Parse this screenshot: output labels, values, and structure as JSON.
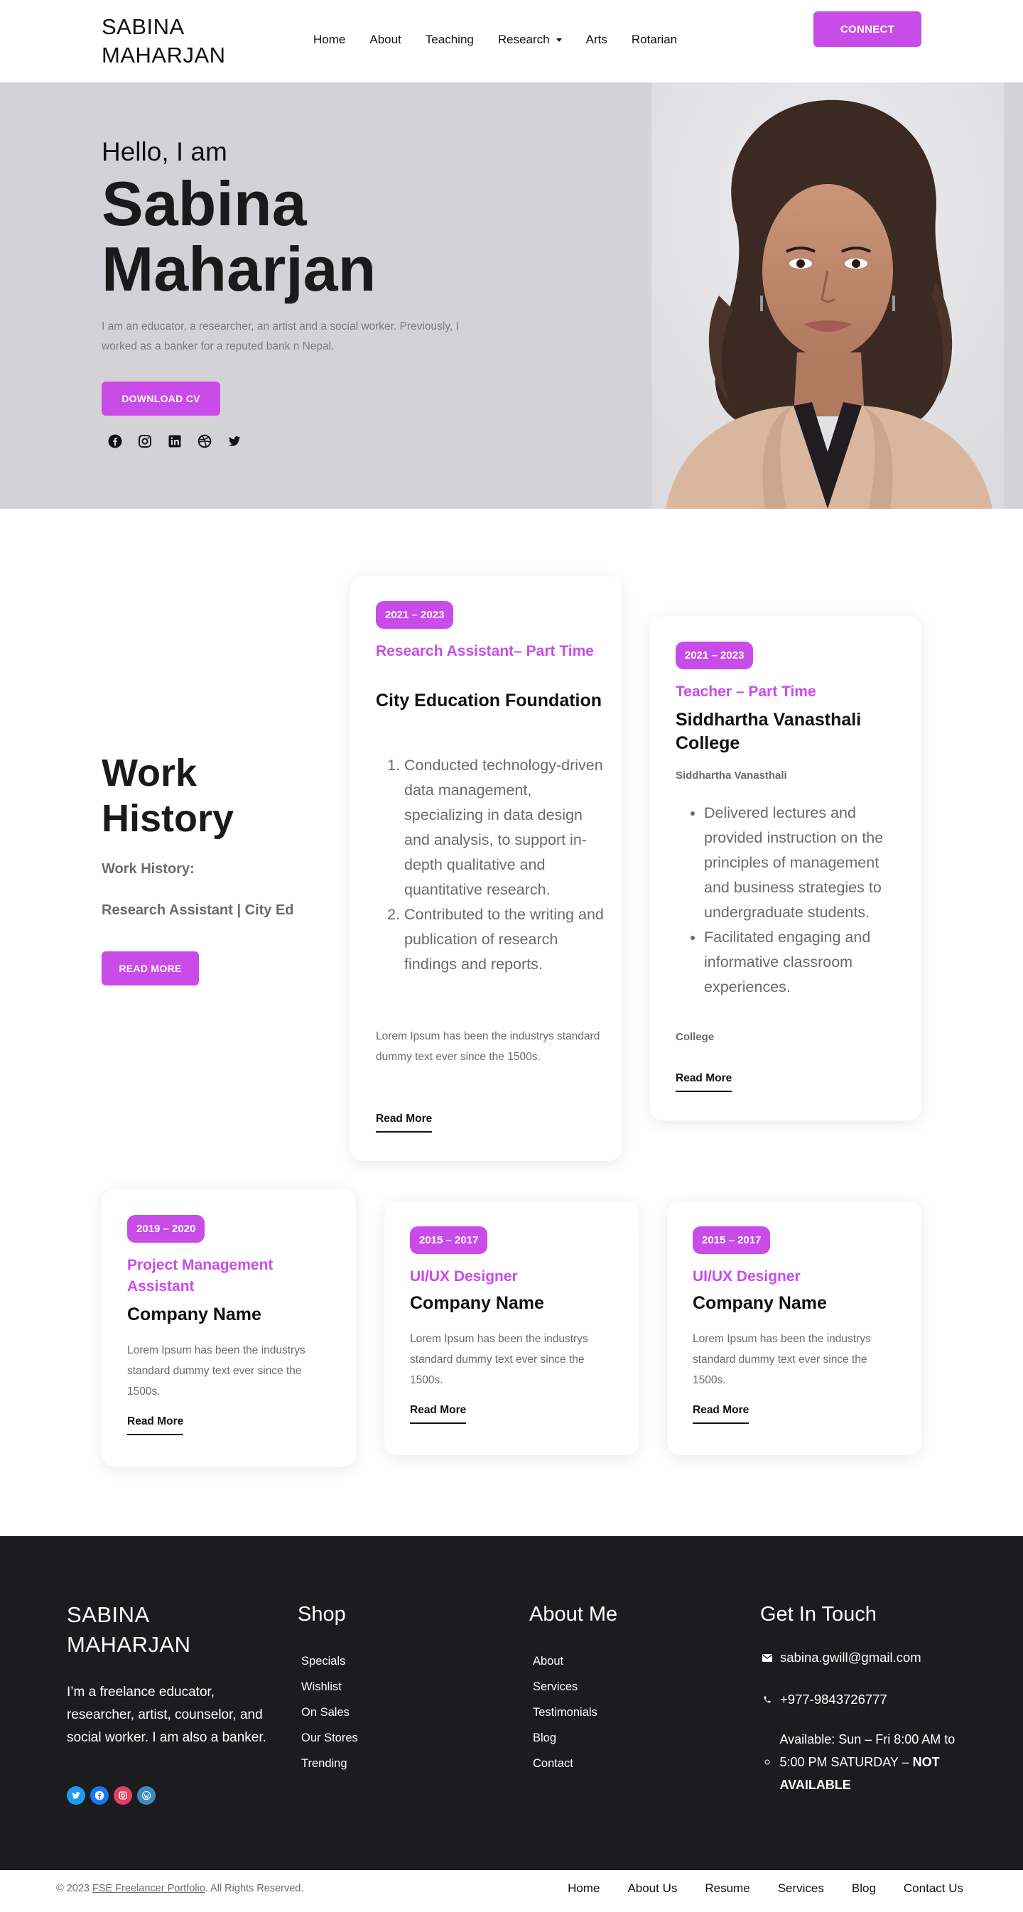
{
  "header": {
    "brand": "SABINA MAHARJAN",
    "nav": [
      "Home",
      "About",
      "Teaching",
      "Research",
      "Arts",
      "Rotarian"
    ],
    "connect_label": "CONNECT"
  },
  "hero": {
    "greeting": "Hello, I am",
    "name": "Sabina Maharjan",
    "description": "I am an educator, a researcher, an artist and a social worker. Previously, I worked as a banker for a reputed bank n Nepal.",
    "download_label": "DOWNLOAD CV",
    "social_icons": [
      "facebook-icon",
      "instagram-icon",
      "linkedin-icon",
      "dribbble-icon",
      "twitter-icon"
    ]
  },
  "work": {
    "title": "Work History",
    "subtitle1": "Work History:",
    "subtitle2": "Research Assistant | City Ed",
    "read_more_label": "READ MORE",
    "cards": [
      {
        "years": "2021 – 2023",
        "role": "Research Assistant– Part Time",
        "company": "City Education Foundation",
        "items": [
          "Conducted technology-driven data management, specializing in data design and analysis, to support in-depth qualitative and quantitative research.",
          "Contributed to the writing and publication of research findings and reports."
        ],
        "text": "Lorem Ipsum has been the industrys standard dummy text ever since the 1500s.",
        "link": "Read More"
      },
      {
        "years": "2021 – 2023",
        "role": "Teacher – Part Time",
        "company": "Siddhartha Vanasthali College",
        "org": "Siddhartha Vanasthali",
        "items": [
          "Delivered lectures and provided instruction on the principles of management and business strategies to undergraduate students.",
          "Facilitated engaging and informative classroom experiences."
        ],
        "note": "College",
        "link": "Read More"
      },
      {
        "years": "2019 – 2020",
        "role": "Project Management Assistant",
        "company": "Company Name",
        "text": "Lorem Ipsum has been the industrys standard dummy text ever since the 1500s.",
        "link": "Read More"
      },
      {
        "years": "2015 – 2017",
        "role": "UI/UX Designer",
        "company": "Company Name",
        "text": "Lorem Ipsum has been the industrys standard dummy text ever since the 1500s.",
        "link": "Read More"
      },
      {
        "years": "2015 – 2017",
        "role": "UI/UX Designer",
        "company": "Company Name",
        "text": "Lorem Ipsum has been the industrys standard dummy text ever since the 1500s.",
        "link": "Read More"
      }
    ]
  },
  "footer": {
    "brand": "SABINA MAHARJAN",
    "about": "I’m a freelance educator, researcher, artist, counselor, and social worker. I am also a banker.",
    "social_icons": [
      "twitter-icon",
      "facebook-icon",
      "instagram-icon",
      "wordpress-icon"
    ],
    "shop_title": "Shop",
    "shop_links": [
      "Specials",
      "Wishlist",
      "On Sales",
      "Our Stores",
      "Trending"
    ],
    "about_title": "About Me",
    "about_links": [
      "About",
      "Services",
      "Testimonials",
      "Blog",
      "Contact"
    ],
    "contact_title": "Get In Touch",
    "email": "sabina.gwill@gmail.com",
    "phone": "+977-9843726777",
    "hours": "Available: Sun – Fri 8:00 AM to 5:00 PM SATURDAY –",
    "hours_bold": "NOT AVAILABLE"
  },
  "bottom": {
    "copy_prefix": "© 2023",
    "copy_link": "FSE Freelancer Portfolio",
    "copy_suffix": ". All Rights Reserved.",
    "nav": [
      "Home",
      "About Us",
      "Resume",
      "Services",
      "Blog",
      "Contact Us"
    ]
  },
  "colors": {
    "accent": "#c94ce8",
    "hero_bg": "#d3d3d7",
    "footer_bg": "#1c1c1f"
  }
}
